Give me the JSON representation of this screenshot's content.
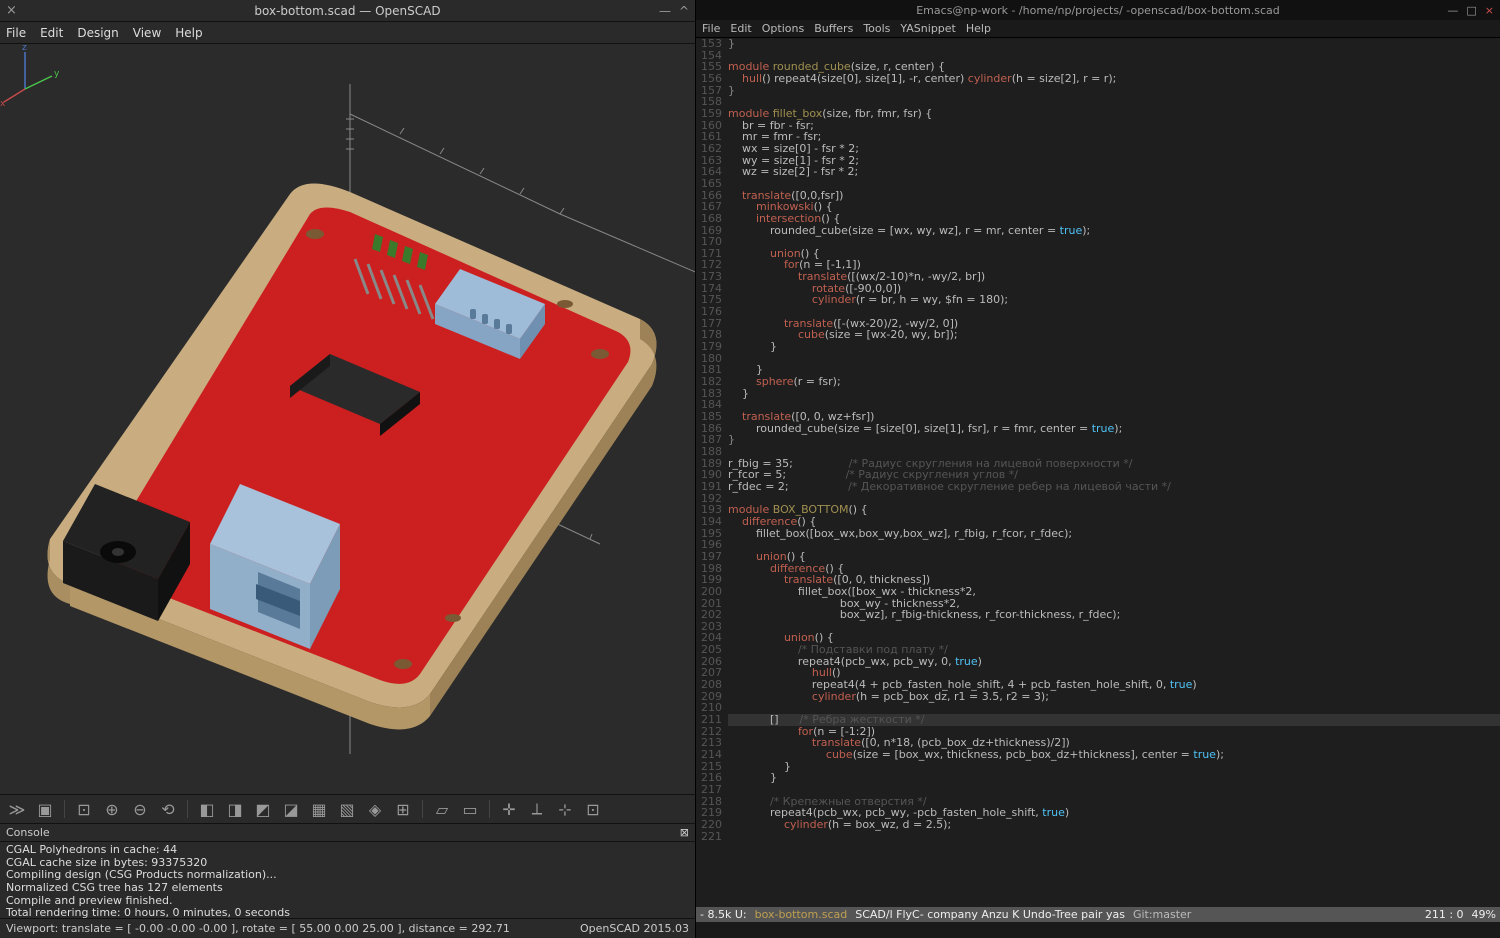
{
  "openscad": {
    "title": "box-bottom.scad — OpenSCAD",
    "close_glyph": "×",
    "min_glyph": "—",
    "max_glyph": "^",
    "menu": [
      "File",
      "Edit",
      "Design",
      "View",
      "Help"
    ],
    "console_title": "Console",
    "console_close": "⊠",
    "console_lines": [
      "CGAL Polyhedrons in cache: 44",
      "CGAL cache size in bytes: 93375320",
      "Compiling design (CSG Products normalization)...",
      "Normalized CSG tree has 127 elements",
      "Compile and preview finished.",
      "Total rendering time: 0 hours, 0 minutes, 0 seconds"
    ],
    "status_left": "Viewport: translate = [ -0.00 -0.00 -0.00 ], rotate = [ 55.00 0.00 25.00 ], distance = 292.71",
    "status_right": "OpenSCAD 2015.03",
    "axis_z": "z",
    "axis_y": "y",
    "axis_x": "x",
    "toolbar_icons": [
      {
        "name": "preview-icon",
        "g": "≫"
      },
      {
        "name": "render-icon",
        "g": "▣"
      },
      {
        "name": "sep"
      },
      {
        "name": "zoom-all-icon",
        "g": "⊡"
      },
      {
        "name": "zoom-in-icon",
        "g": "⊕"
      },
      {
        "name": "zoom-out-icon",
        "g": "⊖"
      },
      {
        "name": "reset-view-icon",
        "g": "⟲"
      },
      {
        "name": "sep"
      },
      {
        "name": "view-right-icon",
        "g": "◧"
      },
      {
        "name": "view-top-icon",
        "g": "◨"
      },
      {
        "name": "view-bottom-icon",
        "g": "◩"
      },
      {
        "name": "view-left-icon",
        "g": "◪"
      },
      {
        "name": "view-front-icon",
        "g": "▦"
      },
      {
        "name": "view-back-icon",
        "g": "▧"
      },
      {
        "name": "view-diag-icon",
        "g": "◈"
      },
      {
        "name": "center-icon",
        "g": "⊞"
      },
      {
        "name": "sep"
      },
      {
        "name": "persp-icon",
        "g": "▱"
      },
      {
        "name": "ortho-icon",
        "g": "▭"
      },
      {
        "name": "sep"
      },
      {
        "name": "axes-icon",
        "g": "✛"
      },
      {
        "name": "scale-icon",
        "g": "⟂"
      },
      {
        "name": "edges-icon",
        "g": "⊹"
      },
      {
        "name": "crosshair-icon",
        "g": "⊡"
      }
    ]
  },
  "emacs": {
    "title": "Emacs@np-work - /home/np/projects/                                             -openscad/box-bottom.scad",
    "menu": [
      "File",
      "Edit",
      "Options",
      "Buffers",
      "Tools",
      "YASnippet",
      "Help"
    ],
    "modeline": {
      "left": "- 8.5k U:",
      "buffer": "box-bottom.scad",
      "modes": "SCAD/l FlyC- company Anzu K Undo-Tree pair yas",
      "git": "Git:master",
      "position": "211 : 0",
      "percent": "49%"
    },
    "first_line": 153,
    "code": [
      {
        "t": "<op>}</op>"
      },
      {
        "t": " "
      },
      {
        "t": "<kw>module</kw> <id>rounded_cube</id>(size, r, center) {"
      },
      {
        "t": "    <kw>hull</kw>() repeat4(size[0], size[1], -r, center) <kw>cylinder</kw>(h = size[2], r = r);"
      },
      {
        "t": "<op>}</op>"
      },
      {
        "t": " "
      },
      {
        "t": "<kw>module</kw> <id>fillet_box</id>(size, fbr, fmr, fsr) {"
      },
      {
        "t": "    br = fbr - fsr;"
      },
      {
        "t": "    mr = fmr - fsr;"
      },
      {
        "t": "    wx = size[0] - fsr * 2;"
      },
      {
        "t": "    wy = size[1] - fsr * 2;"
      },
      {
        "t": "    wz = size[2] - fsr * 2;"
      },
      {
        "t": " "
      },
      {
        "t": "    <kw>translate</kw>([0,0,fsr])"
      },
      {
        "t": "        <kw>minkowski</kw>() {"
      },
      {
        "t": "        <kw>intersection</kw>() {"
      },
      {
        "t": "            rounded_cube(size = [wx, wy, wz], r = mr, center = <val>true</val>);"
      },
      {
        "t": " "
      },
      {
        "t": "            <kw>union</kw>() {"
      },
      {
        "t": "                <kw>for</kw>(n = [-1,1])"
      },
      {
        "t": "                    <kw>translate</kw>([(wx/2-10)*n, -wy/2, br])"
      },
      {
        "t": "                        <kw>rotate</kw>([-90,0,0])"
      },
      {
        "t": "                        <kw>cylinder</kw>(r = br, h = wy, $fn = 180);"
      },
      {
        "t": " "
      },
      {
        "t": "                <kw>translate</kw>([-(wx-20)/2, -wy/2, 0])"
      },
      {
        "t": "                    <kw>cube</kw>(size = [wx-20, wy, br]);"
      },
      {
        "t": "            }"
      },
      {
        "t": " "
      },
      {
        "t": "        }"
      },
      {
        "t": "        <kw>sphere</kw>(r = fsr);"
      },
      {
        "t": "    }"
      },
      {
        "t": " "
      },
      {
        "t": "    <kw>translate</kw>([0, 0, wz+fsr])"
      },
      {
        "t": "        rounded_cube(size = [size[0], size[1], fsr], r = fmr, center = <val>true</val>);"
      },
      {
        "t": "<op>}</op>"
      },
      {
        "t": " "
      },
      {
        "t": "r_fbig = 35;                <cm>/* Радиус скругления на лицевой поверхности */</cm>"
      },
      {
        "t": "r_fcor = 5;                 <cm>/* Радиус скругления углов */</cm>"
      },
      {
        "t": "r_fdec = 2;                 <cm>/* Декоративное скругление ребер на лицевой части */</cm>"
      },
      {
        "t": " "
      },
      {
        "t": "<kw>module</kw> <id>BOX_BOTTOM</id>() {"
      },
      {
        "t": "    <kw>difference</kw>() {"
      },
      {
        "t": "        fillet_box([box_wx,box_wy,box_wz], r_fbig, r_fcor, r_fdec);"
      },
      {
        "t": " "
      },
      {
        "t": "        <kw>union</kw>() {"
      },
      {
        "t": "            <kw>difference</kw>() {"
      },
      {
        "t": "                <kw>translate</kw>([0, 0, thickness])"
      },
      {
        "t": "                    fillet_box([box_wx - thickness*2,"
      },
      {
        "t": "                                box_wy - thickness*2,"
      },
      {
        "t": "                                box_wz], r_fbig-thickness, r_fcor-thickness, r_fdec);"
      },
      {
        "t": " "
      },
      {
        "t": "                <kw>union</kw>() {"
      },
      {
        "t": "                    <cm>/* Подставки под плату */</cm>"
      },
      {
        "t": "                    repeat4(pcb_wx, pcb_wy, 0, <val>true</val>)"
      },
      {
        "t": "                        <kw>hull</kw>()"
      },
      {
        "t": "                        repeat4(4 + pcb_fasten_hole_shift, 4 + pcb_fasten_hole_shift, 0, <val>true</val>)"
      },
      {
        "t": "                        <kw>cylinder</kw>(h = pcb_box_dz, r1 = 3.5, r2 = 3);"
      },
      {
        "t": " "
      },
      {
        "t": "<hl>            []      <cm>/* Ребра жесткости */</cm></hl>"
      },
      {
        "t": "                    <kw>for</kw>(n = [-1:2])"
      },
      {
        "t": "                        <kw>translate</kw>([0, n*18, (pcb_box_dz+thickness)/2])"
      },
      {
        "t": "                            <kw>cube</kw>(size = [box_wx, thickness, pcb_box_dz+thickness], center = <val>true</val>);"
      },
      {
        "t": "                }"
      },
      {
        "t": "            }"
      },
      {
        "t": " "
      },
      {
        "t": "            <cm>/* Крепежные отверстия */</cm>"
      },
      {
        "t": "            repeat4(pcb_wx, pcb_wy, -pcb_fasten_hole_shift, <val>true</val>)"
      },
      {
        "t": "                <kw>cylinder</kw>(h = box_wz, d = 2.5);"
      },
      {
        "t": " "
      }
    ]
  }
}
